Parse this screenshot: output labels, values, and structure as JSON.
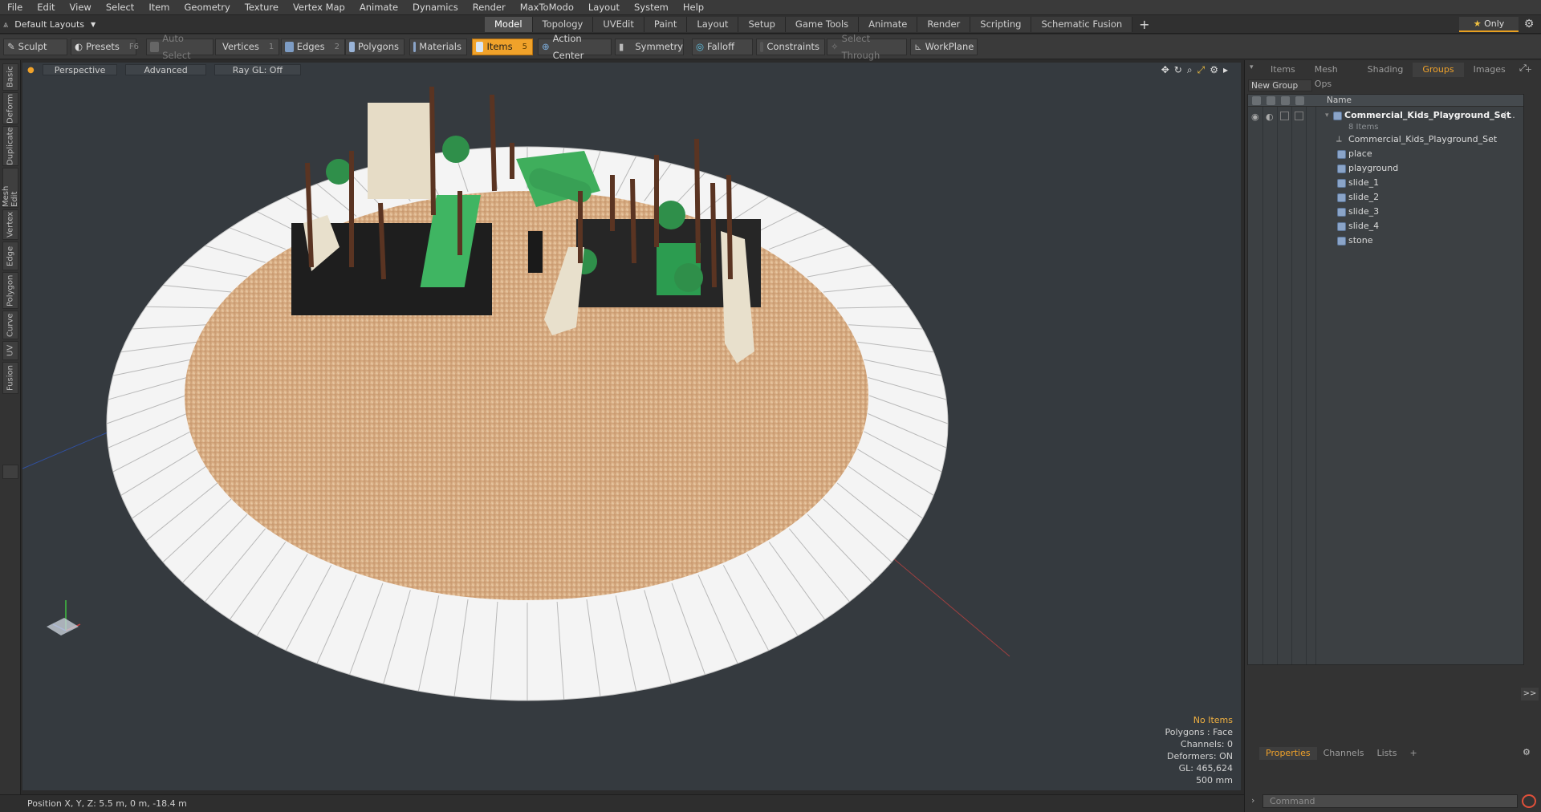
{
  "menu": [
    "File",
    "Edit",
    "View",
    "Select",
    "Item",
    "Geometry",
    "Texture",
    "Vertex Map",
    "Animate",
    "Dynamics",
    "Render",
    "MaxToModo",
    "Layout",
    "System",
    "Help"
  ],
  "layout_dropdown": "Default Layouts",
  "layout_tabs": [
    {
      "label": "Model",
      "active": true
    },
    {
      "label": "Topology"
    },
    {
      "label": "UVEdit"
    },
    {
      "label": "Paint"
    },
    {
      "label": "Layout"
    },
    {
      "label": "Setup"
    },
    {
      "label": "Game Tools"
    },
    {
      "label": "Animate"
    },
    {
      "label": "Render"
    },
    {
      "label": "Scripting"
    },
    {
      "label": "Schematic Fusion"
    }
  ],
  "add_tab": "+",
  "only_label": "Only",
  "toolbar": {
    "sculpt": "Sculpt",
    "presets": "Presets",
    "presets_key": "F6",
    "auto_select": "Auto Select",
    "vertices": "Vertices",
    "vertices_count": "1",
    "edges": "Edges",
    "edges_count": "2",
    "polygons": "Polygons",
    "materials": "Materials",
    "items": "Items",
    "items_count": "5",
    "action_center": "Action Center",
    "symmetry": "Symmetry",
    "falloff": "Falloff",
    "constraints": "Constraints",
    "select_through": "Select Through",
    "workplane": "WorkPlane"
  },
  "left_tabs": [
    "Basic",
    "Deform",
    "Duplicate",
    "Mesh Edit",
    "Vertex",
    "Edge",
    "Polygon",
    "Curve",
    "UV",
    "Fusion"
  ],
  "viewport": {
    "view": "Perspective",
    "shading": "Advanced",
    "raygl": "Ray GL: Off",
    "info": {
      "selection": "No Items",
      "polygons": "Polygons : Face",
      "channels": "Channels: 0",
      "deformers": "Deformers: ON",
      "gl": "GL: 465,624",
      "scale": "500 mm"
    }
  },
  "status": "Position X, Y, Z:   5.5 m, 0 m, -18.4 m",
  "right_panel": {
    "tabs": [
      {
        "label": "Items"
      },
      {
        "label": "Mesh Ops"
      },
      {
        "label": "Shading"
      },
      {
        "label": "Groups",
        "active": true
      },
      {
        "label": "Images"
      },
      {
        "label": "+"
      }
    ],
    "new_group": "New Group",
    "column_name": "Name",
    "root": {
      "name": "Commercial_Kids_Playground_Set",
      "suffix": "(...",
      "count": "8 Items"
    },
    "items": [
      "Commercial_Kids_Playground_Set",
      "place",
      "playground",
      "slide_1",
      "slide_2",
      "slide_3",
      "slide_4",
      "stone"
    ],
    "bottom_tabs": [
      {
        "label": "Properties",
        "active": true
      },
      {
        "label": "Channels"
      },
      {
        "label": "Lists"
      },
      {
        "label": "+"
      }
    ],
    "command_placeholder": "Command",
    "expand": ">>"
  },
  "colors": {
    "accent": "#f0a22a",
    "viewport_bg": "#353a3f",
    "panel_bg": "#333333"
  }
}
